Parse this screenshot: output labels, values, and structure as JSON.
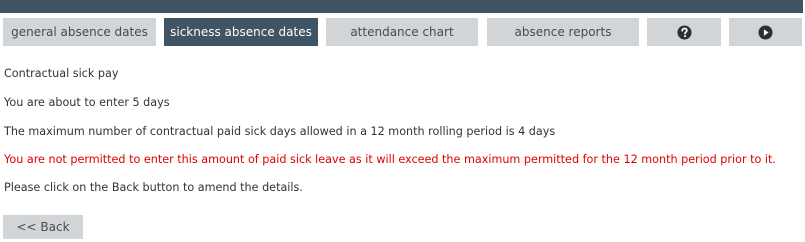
{
  "tabs": [
    {
      "label": "general absence dates",
      "active": false
    },
    {
      "label": "sickness absence dates",
      "active": true
    },
    {
      "label": "attendance chart",
      "active": false
    },
    {
      "label": "absence reports",
      "active": false
    }
  ],
  "icon_tabs": [
    {
      "icon": "help-icon"
    },
    {
      "icon": "play-icon"
    }
  ],
  "content": {
    "heading": "Contractual sick pay",
    "days_line": "You are about to enter 5 days",
    "max_line": "The maximum number of contractual paid sick days allowed in a 12 month rolling period is 4 days",
    "error_line": "You are not permitted to enter this amount of paid sick leave as it will exceed the maximum permitted for the 12 month period prior to it.",
    "instruction_line": "Please click on the Back button to amend the details."
  },
  "back_button": {
    "label": "<< Back"
  },
  "colors": {
    "nav_bar": "#3f5465",
    "tab_inactive": "#d2d5d8",
    "error_text": "#e00000"
  }
}
